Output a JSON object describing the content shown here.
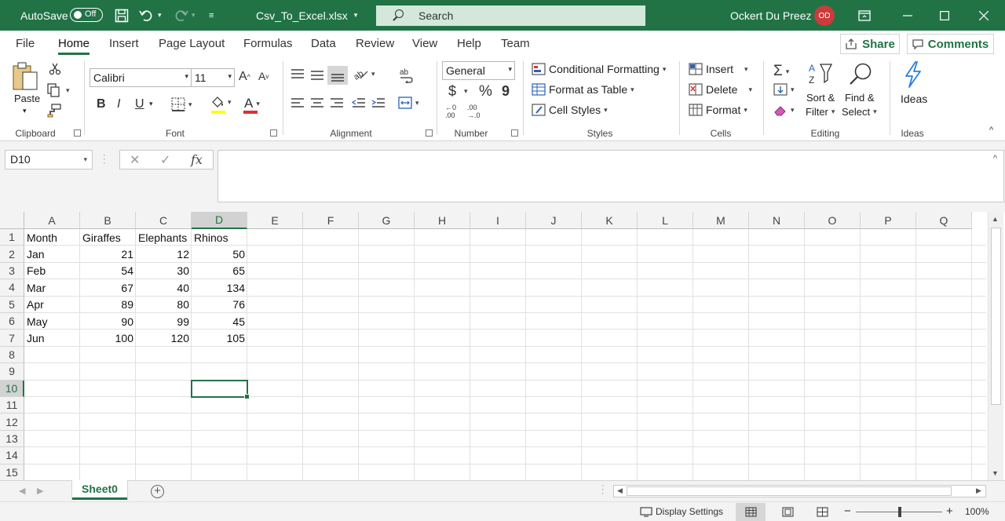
{
  "titlebar": {
    "autosave_label": "AutoSave",
    "autosave_state": "Off",
    "filename": "Csv_To_Excel.xlsx",
    "search_placeholder": "Search",
    "username": "Ockert Du Preez",
    "avatar_initials": "OD"
  },
  "tabs": [
    "File",
    "Home",
    "Insert",
    "Page Layout",
    "Formulas",
    "Data",
    "Review",
    "View",
    "Help",
    "Team"
  ],
  "active_tab": "Home",
  "share_label": "Share",
  "comments_label": "Comments",
  "ribbon": {
    "clipboard": {
      "paste": "Paste",
      "label": "Clipboard"
    },
    "font": {
      "name": "Calibri",
      "size": "11",
      "label": "Font",
      "bold": "B",
      "italic": "I",
      "underline": "U",
      "fill_color": "#ffff00",
      "font_color": "#e03030"
    },
    "alignment": {
      "label": "Alignment"
    },
    "number": {
      "format": "General",
      "currency": "$",
      "percent": "%",
      "comma": "9",
      "label": "Number"
    },
    "styles": {
      "conditional": "Conditional Formatting",
      "table": "Format as Table",
      "cell_styles": "Cell Styles",
      "label": "Styles"
    },
    "cells": {
      "insert": "Insert",
      "delete": "Delete",
      "format": "Format",
      "label": "Cells"
    },
    "editing": {
      "sort_1": "Sort &",
      "sort_2": "Filter",
      "find_1": "Find &",
      "find_2": "Select",
      "label": "Editing"
    },
    "ideas": {
      "button": "Ideas",
      "label": "Ideas"
    }
  },
  "formula_bar": {
    "name_box": "D10",
    "cancel": "✕",
    "enter": "✓",
    "fx": "fx",
    "value": ""
  },
  "sheet": {
    "columns": [
      "A",
      "B",
      "C",
      "D",
      "E",
      "F",
      "G",
      "H",
      "I",
      "J",
      "K",
      "L",
      "M",
      "N",
      "O",
      "P",
      "Q"
    ],
    "rows": [
      "1",
      "2",
      "3",
      "4",
      "5",
      "6",
      "7",
      "8",
      "9",
      "10",
      "11",
      "12",
      "13",
      "14",
      "15"
    ],
    "selected_cell": "D10",
    "data": [
      [
        "Month",
        "Giraffes",
        "Elephants",
        "Rhinos"
      ],
      [
        "Jan",
        "21",
        "12",
        "50"
      ],
      [
        "Feb",
        "54",
        "30",
        "65"
      ],
      [
        "Mar",
        "67",
        "40",
        "134"
      ],
      [
        "Apr",
        "89",
        "80",
        "76"
      ],
      [
        "May",
        "90",
        "99",
        "45"
      ],
      [
        "Jun",
        "100",
        "120",
        "105"
      ]
    ]
  },
  "sheet_tab": "Sheet0",
  "status": {
    "display_settings": "Display Settings",
    "zoom_minus": "−",
    "zoom_plus": "+",
    "zoom": "100%"
  },
  "colors": {
    "accent": "#217346",
    "avatar": "#c93c3c"
  }
}
